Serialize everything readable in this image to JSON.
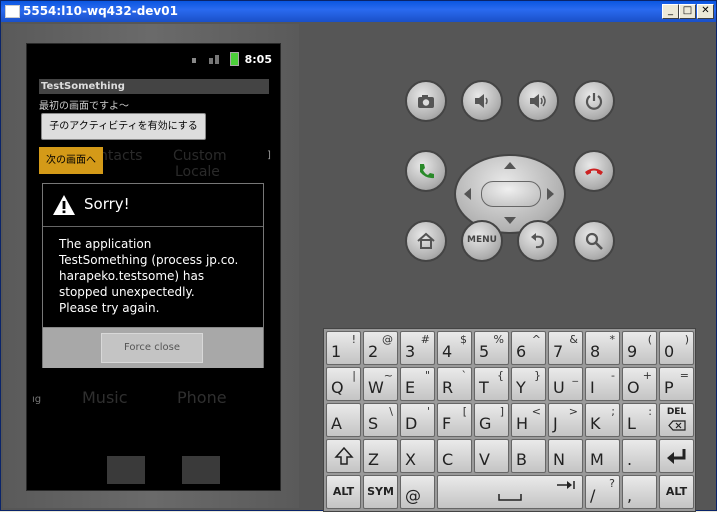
{
  "window": {
    "title": "5554:l10-wq432-dev01",
    "minimize": "_",
    "maximize": "□",
    "close": "✕"
  },
  "status_bar": {
    "time": "8:05"
  },
  "app": {
    "title": "TestSomething",
    "text": "最初の画面ですよ～",
    "button_enable": "子のアクティビティを有効にする",
    "button_next": "次の画面へ"
  },
  "background_labels": {
    "a": "ntacts",
    "b": "Custom",
    "c": "Locale",
    "d": "Music",
    "e": "Phone",
    "f": "ıg"
  },
  "dialog": {
    "title": "Sorry!",
    "message_lines": [
      "The application",
      "TestSomething (process jp.co.",
      "harapeko.testsome) has",
      "stopped unexpectedly.",
      "Please try again."
    ],
    "button": "Force close"
  },
  "controls": {
    "menu": "MENU"
  },
  "keyboard": {
    "row1": [
      {
        "m": "1",
        "s": "!"
      },
      {
        "m": "2",
        "s": "@"
      },
      {
        "m": "3",
        "s": "#"
      },
      {
        "m": "4",
        "s": "$"
      },
      {
        "m": "5",
        "s": "%"
      },
      {
        "m": "6",
        "s": "^"
      },
      {
        "m": "7",
        "s": "&"
      },
      {
        "m": "8",
        "s": "*"
      },
      {
        "m": "9",
        "s": "("
      },
      {
        "m": "0",
        "s": ")"
      }
    ],
    "row2": [
      {
        "m": "Q",
        "s": "|"
      },
      {
        "m": "W",
        "s": "~"
      },
      {
        "m": "E",
        "s": "\""
      },
      {
        "m": "R",
        "s": "`"
      },
      {
        "m": "T",
        "s": "{"
      },
      {
        "m": "Y",
        "s": "}"
      },
      {
        "m": "U",
        "s": "_"
      },
      {
        "m": "I",
        "s": "-"
      },
      {
        "m": "O",
        "s": "+"
      },
      {
        "m": "P",
        "s": "="
      }
    ],
    "row3": [
      {
        "m": "A",
        "s": ""
      },
      {
        "m": "S",
        "s": "\\"
      },
      {
        "m": "D",
        "s": "'"
      },
      {
        "m": "F",
        "s": "["
      },
      {
        "m": "G",
        "s": "]"
      },
      {
        "m": "H",
        "s": "<"
      },
      {
        "m": "J",
        "s": ">"
      },
      {
        "m": "K",
        "s": ";"
      },
      {
        "m": "L",
        "s": ":"
      }
    ],
    "row4": [
      {
        "m": "Z",
        "s": ""
      },
      {
        "m": "X",
        "s": ""
      },
      {
        "m": "C",
        "s": ""
      },
      {
        "m": "V",
        "s": ""
      },
      {
        "m": "B",
        "s": ""
      },
      {
        "m": "N",
        "s": ""
      },
      {
        "m": "M",
        "s": ""
      },
      {
        "m": ".",
        "s": ""
      }
    ],
    "del": "DEL",
    "alt": "ALT",
    "sym": "SYM",
    "at": "@",
    "slash": "/",
    "question": "?",
    "comma": ","
  }
}
